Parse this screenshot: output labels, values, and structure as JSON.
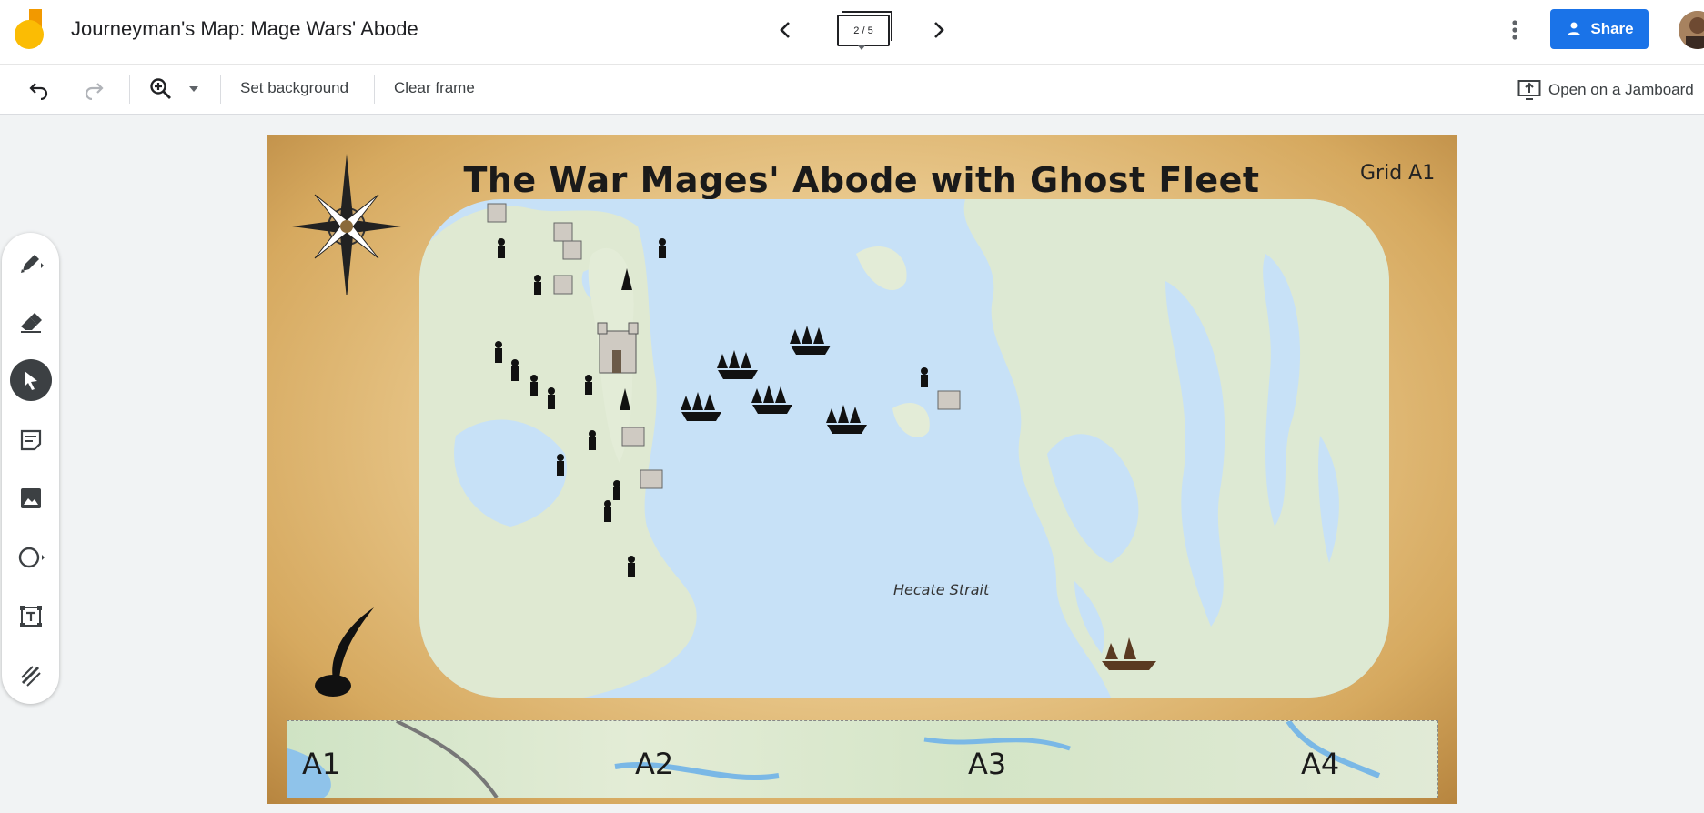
{
  "app": {
    "title": "Journeyman's Map: Mage Wars' Abode",
    "frame_indicator": "2 / 5",
    "share_label": "Share"
  },
  "toolbar": {
    "set_background": "Set background",
    "clear_frame": "Clear frame",
    "open_on_jamboard": "Open on a Jamboard"
  },
  "palette": {
    "items": [
      "pen",
      "eraser",
      "select",
      "sticky-note",
      "image",
      "shape",
      "text-box",
      "laser"
    ],
    "active": "select"
  },
  "canvas": {
    "title": "The War Mages' Abode with Ghost Fleet",
    "grid_label": "Grid A1",
    "place_label": "Hecate Strait",
    "grid_cells": [
      "A1",
      "A2",
      "A3",
      "A4"
    ]
  },
  "colors": {
    "accent": "#1a73e8",
    "sea": "#c7e1f7",
    "land": "#dde9d3",
    "parchment": "#e9c88c"
  }
}
